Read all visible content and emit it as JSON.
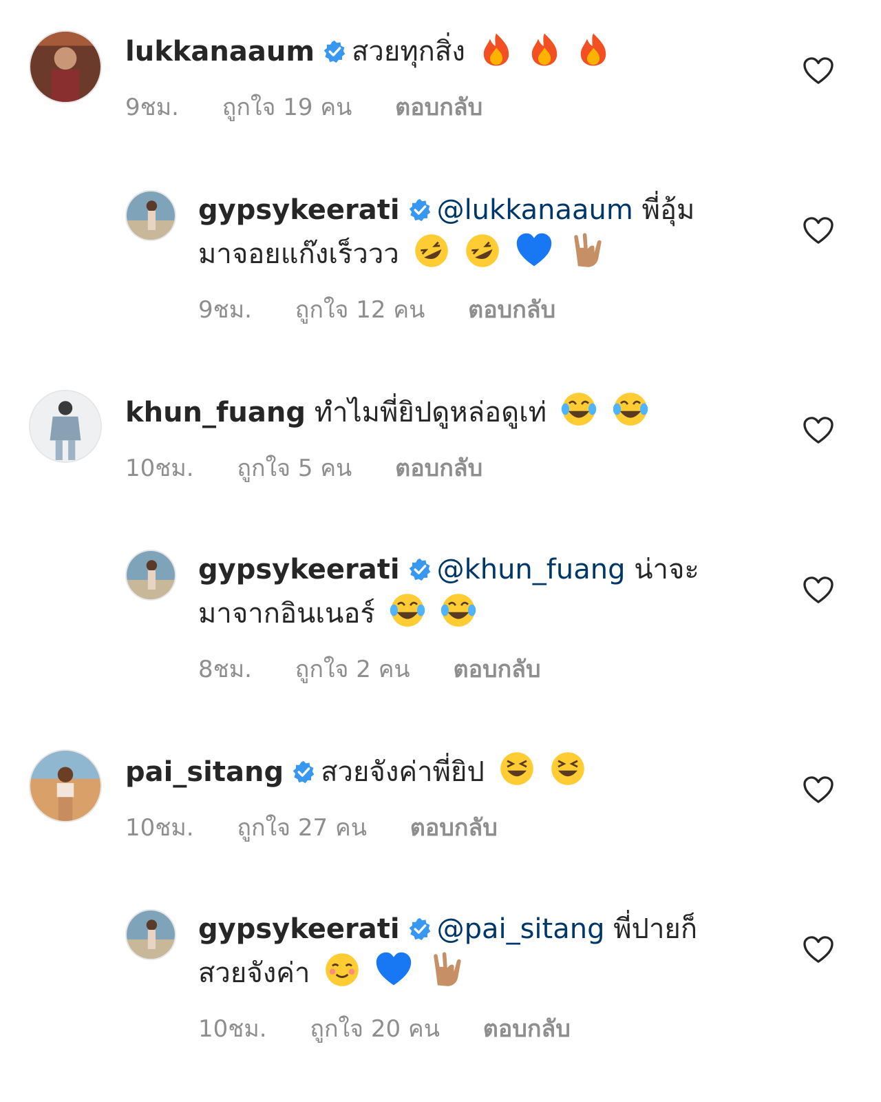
{
  "comments": [
    {
      "username": "lukkanaaum",
      "mention": "",
      "text": "สวยทุกสิ่ง",
      "text2": "",
      "time": "9ชม.",
      "likes": "ถูกใจ 19 คน",
      "reply": "ตอบกลับ",
      "verified": true,
      "emojis": [
        "fire",
        "fire",
        "fire"
      ]
    },
    {
      "username": "gypsykeerati",
      "mention": "@lukkanaaum",
      "text": "พี่อุ้ม",
      "text2": "มาจอยแก๊งเร็ววว",
      "time": "9ชม.",
      "likes": "ถูกใจ 12 คน",
      "reply": "ตอบกลับ",
      "verified": true,
      "emojis": [
        "rofl",
        "rofl",
        "blue-heart",
        "rock-hand"
      ]
    },
    {
      "username": "khun_fuang",
      "mention": "",
      "text": "ทำไมพี่ยิปดูหล่อดูเท่",
      "text2": "",
      "time": "10ชม.",
      "likes": "ถูกใจ 5 คน",
      "reply": "ตอบกลับ",
      "verified": false,
      "emojis": [
        "joy",
        "joy"
      ]
    },
    {
      "username": "gypsykeerati",
      "mention": "@khun_fuang",
      "text": "น่าจะ",
      "text2": "มาจากอินเนอร์",
      "time": "8ชม.",
      "likes": "ถูกใจ 2 คน",
      "reply": "ตอบกลับ",
      "verified": true,
      "emojis": [
        "joy",
        "joy"
      ]
    },
    {
      "username": "pai_sitang",
      "mention": "",
      "text": "สวยจังค่าพี่ยิป",
      "text2": "",
      "time": "10ชม.",
      "likes": "ถูกใจ 27 คน",
      "reply": "ตอบกลับ",
      "verified": true,
      "emojis": [
        "laughing",
        "laughing"
      ]
    },
    {
      "username": "gypsykeerati",
      "mention": "@pai_sitang",
      "text": "พี่ปายก็",
      "text2": "สวยจังค่า",
      "time": "10ชม.",
      "likes": "ถูกใจ 20 คน",
      "reply": "ตอบกลับ",
      "verified": true,
      "emojis": [
        "relaxed",
        "blue-heart",
        "rock-hand"
      ]
    }
  ],
  "colors": {
    "text": "#262626",
    "meta": "#8e8e8e",
    "mention": "#00376b",
    "verified": "#3897f0"
  }
}
